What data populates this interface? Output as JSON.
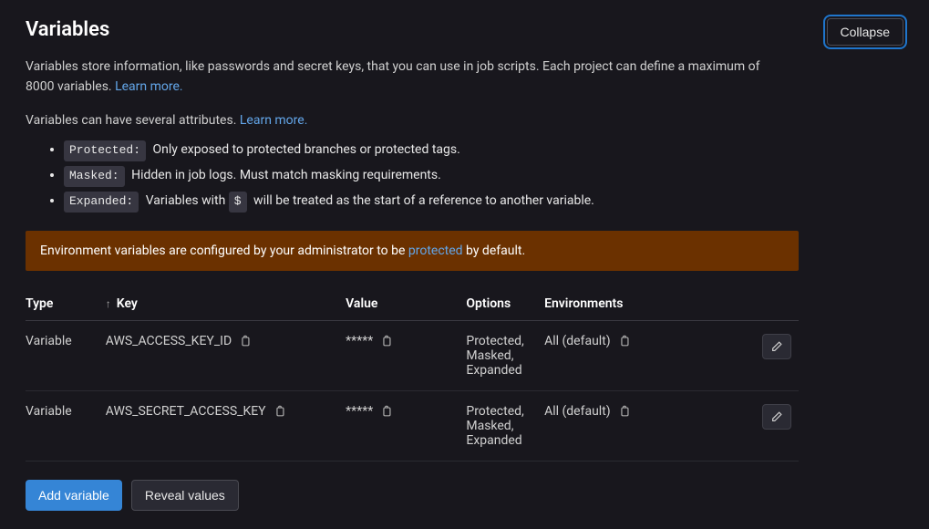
{
  "header": {
    "title": "Variables",
    "collapse_label": "Collapse"
  },
  "intro": {
    "text": "Variables store information, like passwords and secret keys, that you can use in job scripts. Each project can define a maximum of 8000 variables. ",
    "learn_more": "Learn more."
  },
  "attrs_intro": {
    "text": "Variables can have several attributes. ",
    "learn_more": "Learn more."
  },
  "attrs": [
    {
      "badge": "Protected:",
      "desc": "Only exposed to protected branches or protected tags."
    },
    {
      "badge": "Masked:",
      "desc": "Hidden in job logs. Must match masking requirements."
    },
    {
      "badge": "Expanded:",
      "desc_pre": "Variables with ",
      "code": "$",
      "desc_post": " will be treated as the start of a reference to another variable."
    }
  ],
  "alert": {
    "pre": "Environment variables are configured by your administrator to be ",
    "link": "protected",
    "post": " by default."
  },
  "table": {
    "headers": {
      "type": "Type",
      "key": "Key",
      "value": "Value",
      "options": "Options",
      "env": "Environments"
    },
    "rows": [
      {
        "type": "Variable",
        "key": "AWS_ACCESS_KEY_ID",
        "value": "*****",
        "options": "Protected, Masked, Expanded",
        "env": "All (default)"
      },
      {
        "type": "Variable",
        "key": "AWS_SECRET_ACCESS_KEY",
        "value": "*****",
        "options": "Protected, Masked, Expanded",
        "env": "All (default)"
      }
    ]
  },
  "buttons": {
    "add": "Add variable",
    "reveal": "Reveal values"
  }
}
